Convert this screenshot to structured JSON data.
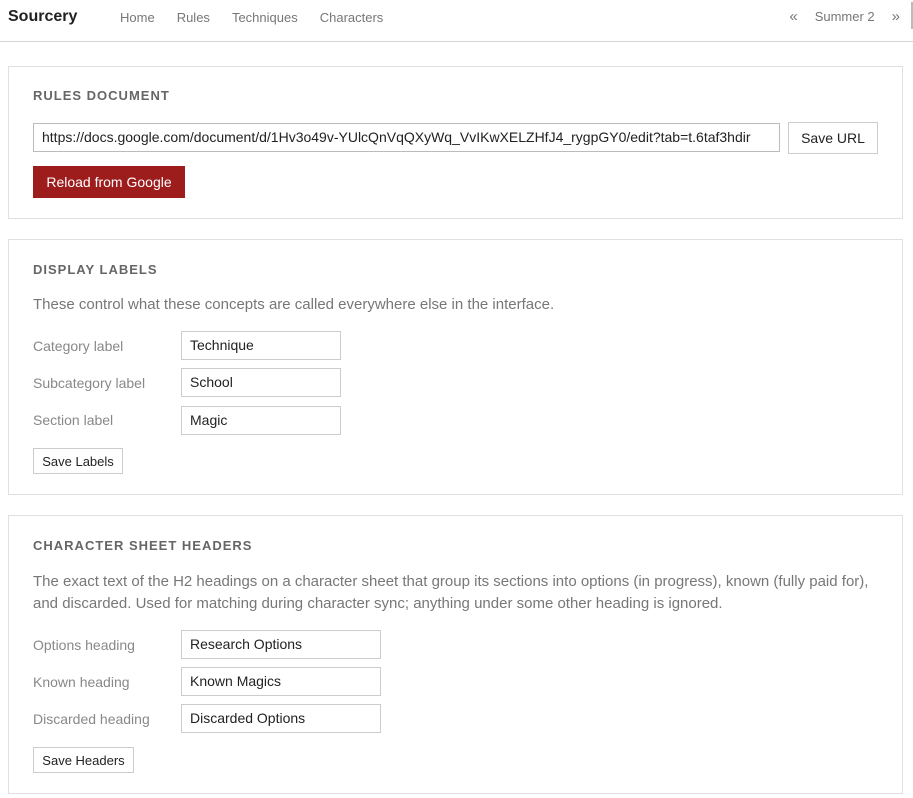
{
  "header": {
    "brand": "Sourcery",
    "nav": [
      "Home",
      "Rules",
      "Techniques",
      "Characters"
    ],
    "season_prev": "«",
    "season_label": "Summer 2",
    "season_next": "»"
  },
  "rules_document": {
    "title": "RULES DOCUMENT",
    "url_value": "https://docs.google.com/document/d/1Hv3o49v-YUlcQnVqQXyWq_VvIKwXELZHfJ4_rygpGY0/edit?tab=t.6taf3hdir",
    "save_url_label": "Save URL",
    "reload_label": "Reload from Google"
  },
  "display_labels": {
    "title": "DISPLAY LABELS",
    "description": "These control what these concepts are called everywhere else in the interface.",
    "fields": [
      {
        "label": "Category label",
        "value": "Technique"
      },
      {
        "label": "Subcategory label",
        "value": "School"
      },
      {
        "label": "Section label",
        "value": "Magic"
      }
    ],
    "save_label": "Save Labels"
  },
  "sheet_headers": {
    "title": "CHARACTER SHEET HEADERS",
    "description": "The exact text of the H2 headings on a character sheet that group its sections into options (in progress), known (fully paid for), and discarded. Used for matching during character sync; anything under some other heading is ignored.",
    "fields": [
      {
        "label": "Options heading",
        "value": "Research Options"
      },
      {
        "label": "Known heading",
        "value": "Known Magics"
      },
      {
        "label": "Discarded heading",
        "value": "Discarded Options"
      }
    ],
    "save_label": "Save Headers"
  },
  "colors": {
    "accent_red": "#9d1c1c",
    "border": "#e0e0e0",
    "muted_text": "#777777"
  }
}
